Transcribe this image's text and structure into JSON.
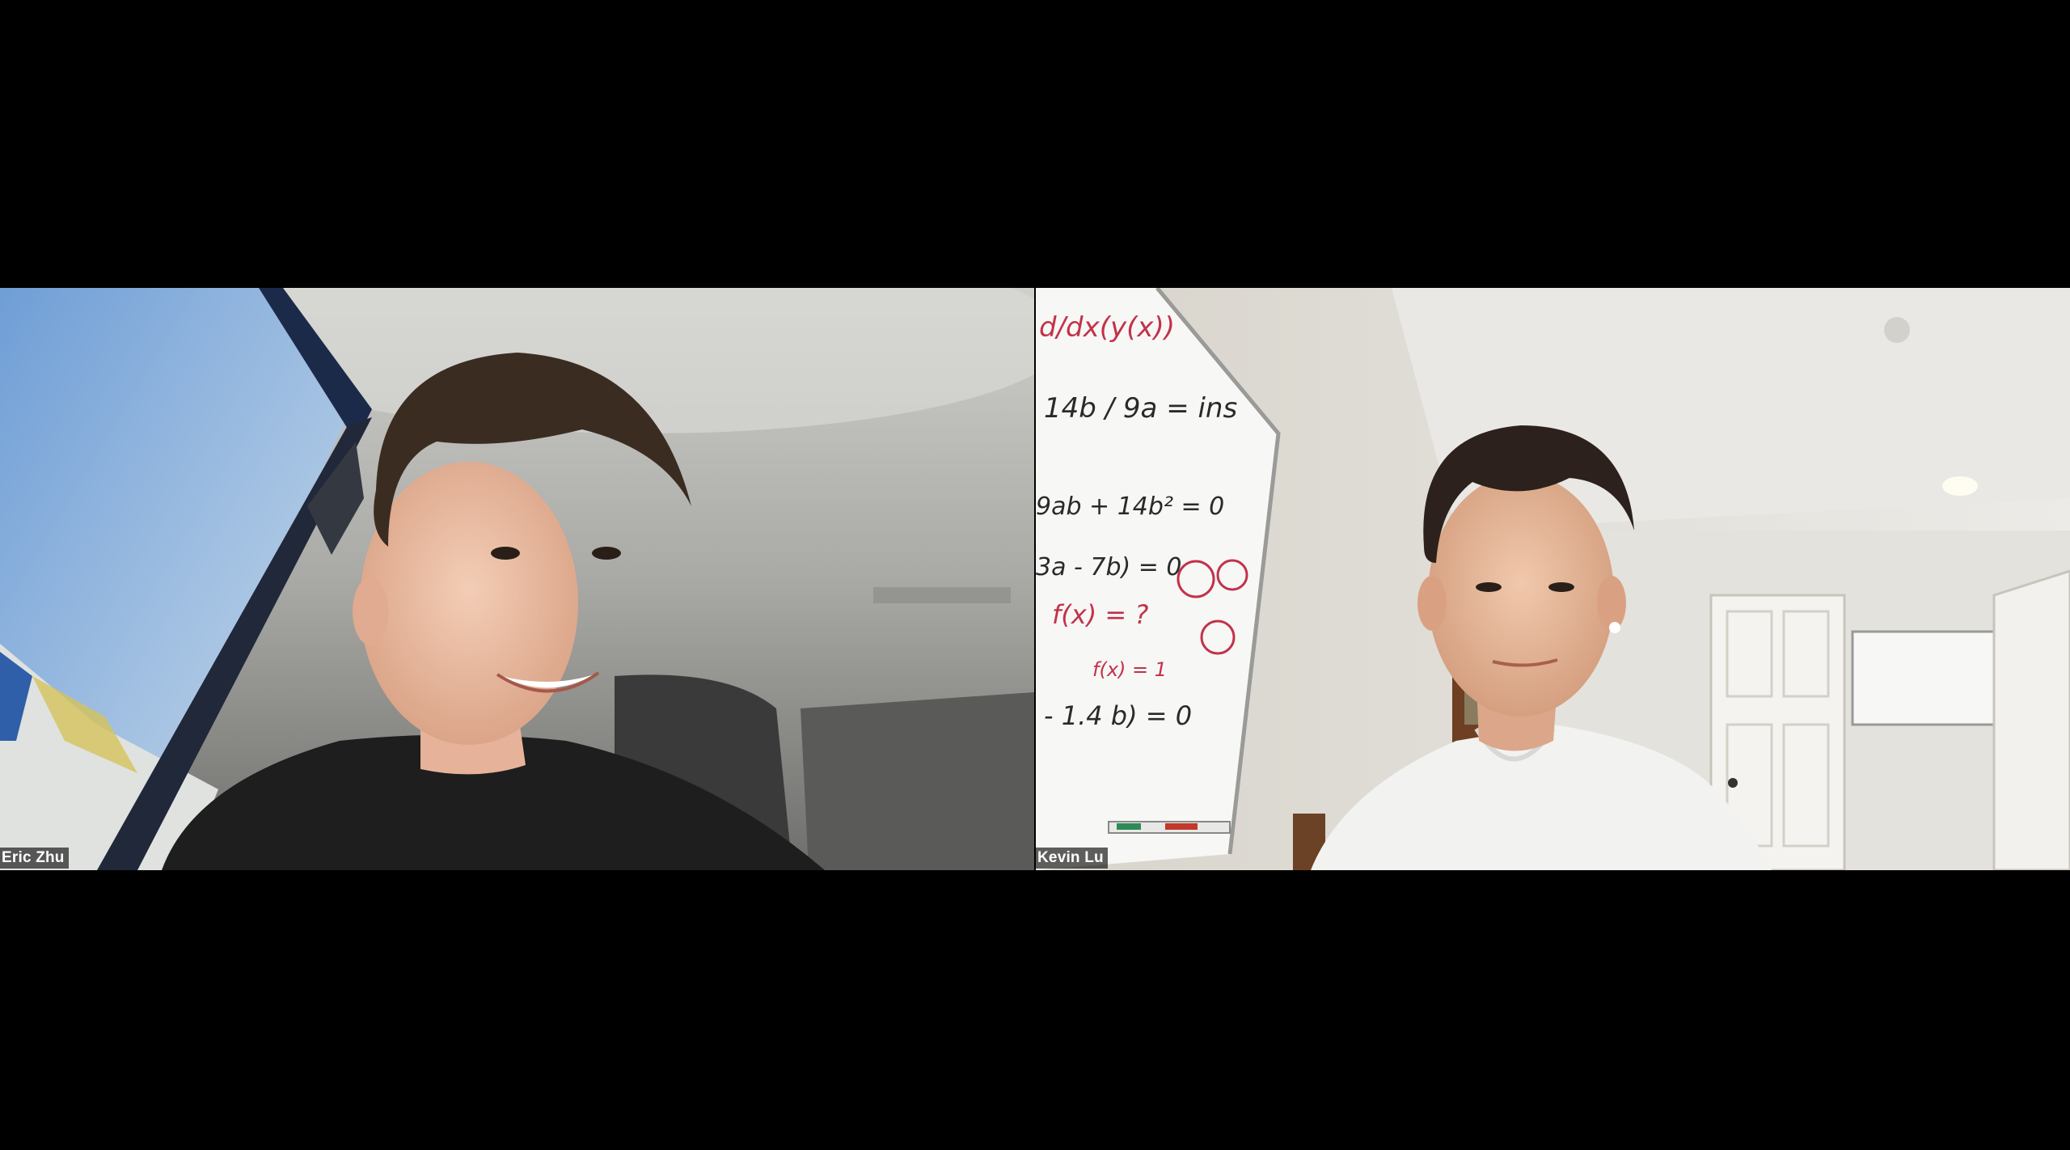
{
  "participants": [
    {
      "name": "Eric Zhu"
    },
    {
      "name": "Kevin Lu"
    }
  ],
  "whiteboard_text": [
    "d/dx(y(x))",
    "14b / 9a = ins",
    "9ab + 14b² = 0",
    "3a - 7b) = 0",
    "f(x) = ?",
    "f(x) = 1",
    "- 1.4 b) = 0"
  ],
  "colors": {
    "background": "#000000",
    "name_tag_bg": "rgba(0,0,0,0.62)",
    "name_tag_text": "#ffffff"
  }
}
